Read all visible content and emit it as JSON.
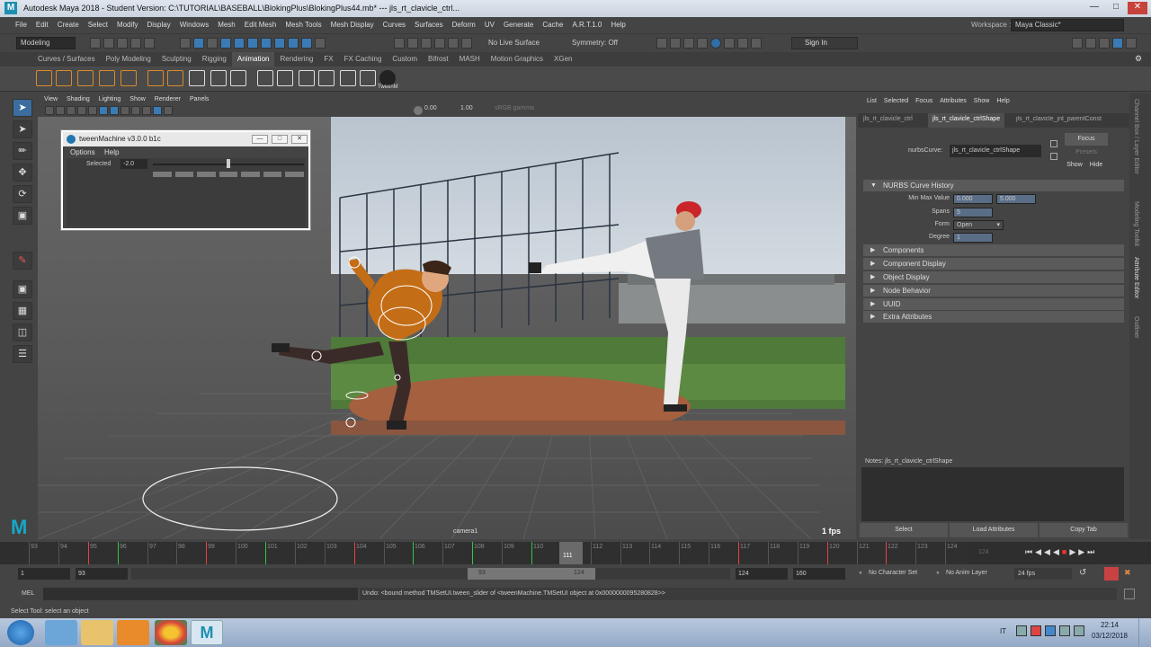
{
  "window": {
    "title": "Autodesk Maya 2018 - Student Version: C:\\TUTORIAL\\BASEBALL\\BlokingPlus\\BlokingPlus44.mb* --- jls_rt_clavicle_ctrl..."
  },
  "menubar": [
    "File",
    "Edit",
    "Create",
    "Select",
    "Modify",
    "Display",
    "Windows",
    "Mesh",
    "Edit Mesh",
    "Mesh Tools",
    "Mesh Display",
    "Curves",
    "Surfaces",
    "Deform",
    "UV",
    "Generate",
    "Cache",
    "A.R.T.1.0",
    "Help"
  ],
  "workspace": {
    "label": "Workspace :",
    "value": "Maya Classic*"
  },
  "status_line": {
    "mode": "Modeling",
    "live_surface": "No Live Surface",
    "symmetry": "Symmetry: Off",
    "sign_in": "Sign In"
  },
  "shelf_tabs": [
    "Curves / Surfaces",
    "Poly Modeling",
    "Sculpting",
    "Rigging",
    "Animation",
    "Rendering",
    "FX",
    "FX Caching",
    "Custom",
    "Bifrost",
    "MASH",
    "Motion Graphics",
    "XGen"
  ],
  "active_shelf_tab": "Animation",
  "shelf_last_label": "TweenM",
  "viewport": {
    "menu": [
      "View",
      "Shading",
      "Lighting",
      "Show",
      "Renderer",
      "Panels"
    ],
    "field_a": "0.00",
    "field_b": "1.00",
    "color_space": "sRGB gamma",
    "camera_label": "camera1",
    "fps": "1 fps"
  },
  "tween_machine": {
    "title": "tweenMachine v3.0.0 b1c",
    "menu": [
      "Options",
      "Help"
    ],
    "selected_label": "Selected",
    "selected_value": "-2.0",
    "slider_value": 0.5
  },
  "attribute_editor": {
    "menu": [
      "List",
      "Selected",
      "Focus",
      "Attributes",
      "Show",
      "Help"
    ],
    "tabs": [
      "jls_rt_clavicle_ctrl",
      "jls_rt_clavicle_ctrlShape",
      "jls_rt_clavicle_jnt_parentConst"
    ],
    "active_tab": "jls_rt_clavicle_ctrlShape",
    "node_type_label": "nurbsCurve:",
    "node_name": "jls_rt_clavicle_ctrlShape",
    "focus_btn": "Focus",
    "presets_btn": "Presets",
    "show_btn": "Show",
    "hide_btn": "Hide",
    "sections": [
      {
        "label": "NURBS Curve History",
        "open": true
      },
      {
        "label": "Components",
        "open": false
      },
      {
        "label": "Component Display",
        "open": false
      },
      {
        "label": "Object Display",
        "open": false
      },
      {
        "label": "Node Behavior",
        "open": false
      },
      {
        "label": "UUID",
        "open": false
      },
      {
        "label": "Extra Attributes",
        "open": false
      }
    ],
    "history": {
      "min_max_label": "Min Max Value",
      "min_value": "0.000",
      "max_value": "5.000",
      "spans_label": "Spans",
      "spans_value": "5",
      "form_label": "Form",
      "form_value": "Open",
      "degree_label": "Degree",
      "degree_value": "1"
    },
    "notes_label": "Notes: jls_rt_clavicle_ctrlShape",
    "buttons": [
      "Select",
      "Load Attributes",
      "Copy Tab"
    ]
  },
  "side_tabs": [
    "Channel Box / Layer Editor",
    "Modeling Toolkit",
    "Attribute Editor",
    "Outliner"
  ],
  "time_slider": {
    "ticks": [
      "93",
      "94",
      "95",
      "96",
      "97",
      "98",
      "99",
      "100",
      "101",
      "102",
      "103",
      "104",
      "105",
      "106",
      "107",
      "108",
      "109",
      "110",
      "111",
      "112",
      "113",
      "114",
      "115",
      "116",
      "117",
      "118",
      "119",
      "120",
      "121",
      "122",
      "123",
      "124"
    ],
    "current_frame": "111",
    "end_label": "124"
  },
  "range_slider": {
    "start": "1",
    "playback_start": "93",
    "range_min_label": "93",
    "range_max_label": "124",
    "playback_end": "124",
    "end": "160",
    "character_set": "No Character Set",
    "anim_layer": "No Anim Layer",
    "fps": "24 fps"
  },
  "command_line": {
    "lang": "MEL",
    "result": "Undo: <bound method TMSetUI.tween_slider of <tweenMachine.TMSetUI object at 0x0000000095280828>>"
  },
  "help_line": "Select Tool: select an object",
  "taskbar": {
    "lang": "IT",
    "time": "22:14",
    "date": "03/12/2018"
  }
}
